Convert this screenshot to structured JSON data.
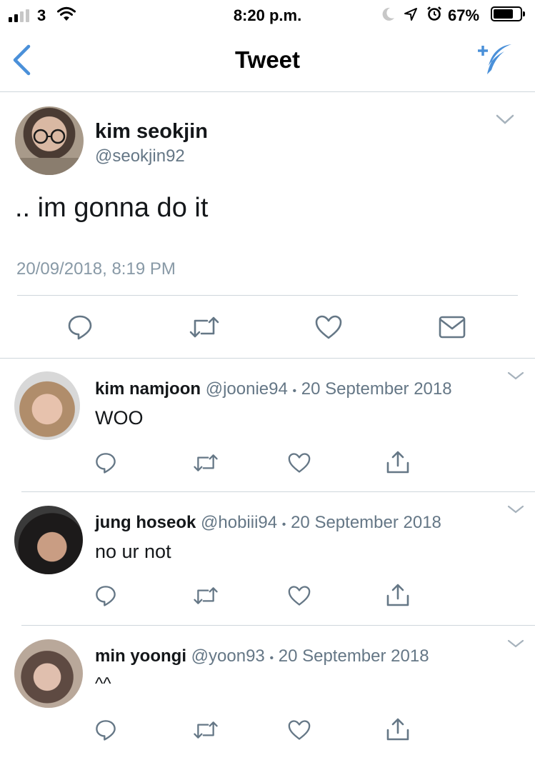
{
  "status_bar": {
    "carrier": "3",
    "time": "8:20 p.m.",
    "battery": "67%"
  },
  "nav": {
    "title": "Tweet"
  },
  "main_tweet": {
    "name": "kim seokjin",
    "handle": "@seokjin92",
    "text": ".. im gonna do it",
    "timestamp": "20/09/2018, 8:19 PM"
  },
  "replies": [
    {
      "name": "kim namjoon",
      "handle": "@joonie94",
      "separator": "•",
      "date": "20 September 2018",
      "text": "WOO"
    },
    {
      "name": "jung hoseok",
      "handle": "@hobiii94",
      "separator": "•",
      "date": "20 September 2018",
      "text": "no ur not"
    },
    {
      "name": "min yoongi",
      "handle": "@yoon93",
      "separator": "•",
      "date": "20 September 2018",
      "text": "^^"
    }
  ],
  "colors": {
    "accent": "#4a90d9",
    "icon_gray": "#657786"
  }
}
